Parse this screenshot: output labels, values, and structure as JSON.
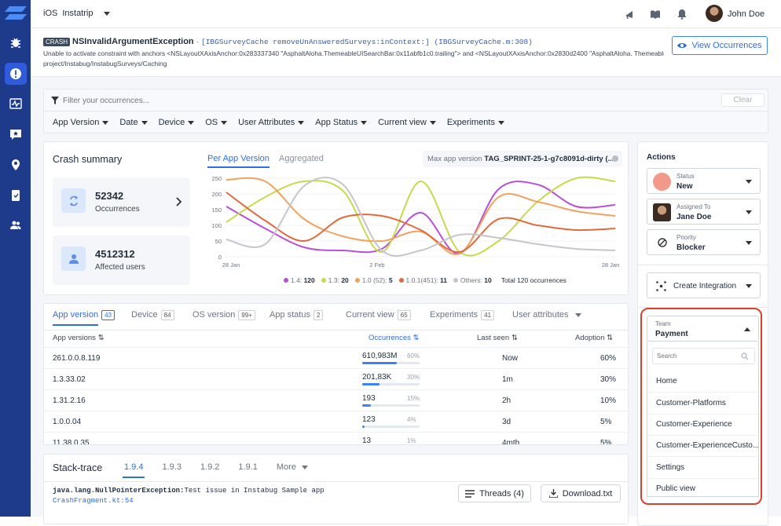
{
  "topbar": {
    "platform": "iOS",
    "app_name": "Instatrip",
    "user_name": "John Doe"
  },
  "crash": {
    "tag": "CRASH",
    "title": "NSInvalidArgumentException",
    "separator": " · ",
    "signature": "[IBGSurveyCache removeUnAnsweredSurveys:inContext:] (IBGSurveyCache.m:308)",
    "message_line1": "Unable to activate constraint with anchors <NSLayoutXAxisAnchor:0x283337340 \"AsphaltAloha.ThemeableUISearchBar:0x11abfb1c0.trailing\"> and <NSLayoutXAxisAnchor:0x2830d2400 \"AsphaltAloha. Themeable",
    "message_line2": "project/Instabug/InstabugSurveys/Caching",
    "view_occurrences": "View Occurrences"
  },
  "filter": {
    "placeholder": "Filter your occurrences...",
    "clear": "Clear",
    "dropdowns": [
      "App Version",
      "Date",
      "Device",
      "OS",
      "User Attributes",
      "App Status",
      "Current view",
      "Experiments"
    ]
  },
  "summary": {
    "title": "Crash summary",
    "occurrences_value": "52342",
    "occurrences_label": "Occurrences",
    "users_value": "4512312",
    "users_label": "Affected users",
    "tab_per_version": "Per App Version",
    "tab_aggregated": "Aggregated",
    "max_version_label": "Max app version",
    "max_version_value": "TAG_SPRINT-25-1-g7c8091d-dirty (..."
  },
  "chart_data": {
    "type": "line",
    "x": [
      "28 Jan",
      "",
      "",
      "",
      "2 Feb",
      "",
      "",
      "",
      "",
      "",
      "28 Jan"
    ],
    "yticks": [
      250,
      200,
      150,
      100,
      50,
      0
    ],
    "ylim": [
      0,
      250
    ],
    "series": [
      {
        "name": "1.4",
        "color": "#b94fd6",
        "values": [
          160,
          90,
          30,
          20,
          25,
          140,
          10,
          215,
          230,
          160,
          165
        ]
      },
      {
        "name": "1.3",
        "color": "#c9d94c",
        "values": [
          110,
          190,
          240,
          210,
          15,
          240,
          15,
          50,
          175,
          250,
          240
        ]
      },
      {
        "name": "1.0 (52)",
        "color": "#f0a35e",
        "values": [
          245,
          240,
          120,
          65,
          50,
          80,
          10,
          190,
          175,
          145,
          130
        ]
      },
      {
        "name": "1.0.1(451)",
        "color": "#e06a3e",
        "values": [
          205,
          115,
          50,
          125,
          130,
          85,
          15,
          120,
          100,
          85,
          90
        ]
      },
      {
        "name": "Others",
        "color": "#c3c6cb",
        "values": [
          55,
          40,
          225,
          230,
          20,
          20,
          70,
          60,
          40,
          25,
          20
        ]
      }
    ],
    "legend": [
      {
        "label": "1.4:",
        "value": "120",
        "color": "#b94fd6"
      },
      {
        "label": "1.3:",
        "value": "20",
        "color": "#c9d94c"
      },
      {
        "label": "1.0 (52):",
        "value": "5",
        "color": "#f0a35e"
      },
      {
        "label": "1.0.1(451):",
        "value": "11",
        "color": "#e06a3e"
      },
      {
        "label": "Others:",
        "value": "10",
        "color": "#c3c6cb"
      }
    ],
    "total": "Total 120 occurrences"
  },
  "table": {
    "tabs": [
      {
        "label": "App version",
        "badge": "43"
      },
      {
        "label": "Device",
        "badge": "84"
      },
      {
        "label": "OS version",
        "badge": "99+"
      },
      {
        "label": "App status",
        "badge": "2"
      },
      {
        "label": "Current view",
        "badge": "65"
      },
      {
        "label": "Experiments",
        "badge": "41"
      },
      {
        "label": "User attributes",
        "badge": ""
      }
    ],
    "headers": {
      "version": "App versions",
      "occurrences": "Occurrences",
      "last_seen": "Last seen",
      "adoption": "Adoption"
    },
    "rows": [
      {
        "version": "261.0.0.8.119",
        "occ": "610,983M",
        "pct": "60%",
        "fill": 0.6,
        "last_seen": "Now",
        "adoption": "60%"
      },
      {
        "version": "1.3.33.02",
        "occ": "201,83K",
        "pct": "30%",
        "fill": 0.3,
        "last_seen": "1m",
        "adoption": "30%"
      },
      {
        "version": "1.31.2.16",
        "occ": "193",
        "pct": "15%",
        "fill": 0.15,
        "last_seen": "2h",
        "adoption": "10%"
      },
      {
        "version": "1.0.0.04",
        "occ": "123",
        "pct": "4%",
        "fill": 0.04,
        "last_seen": "3d",
        "adoption": "5%"
      },
      {
        "version": "11.38.0.35",
        "occ": "13",
        "pct": "1%",
        "fill": 0.01,
        "last_seen": "4mth",
        "adoption": "5%"
      }
    ]
  },
  "stack": {
    "title": "Stack-trace",
    "tabs": [
      "1.9.4",
      "1.9.3",
      "1.9.2",
      "1.9.1",
      "More"
    ],
    "exception": "java.lang.NullPointerException:",
    "exception_msg": "Test issue in Instabug Sample app",
    "location": "CrashFragment.kt:54",
    "threads": "Threads (4)",
    "download": "Download.txt"
  },
  "actions": {
    "title": "Actions",
    "status_label": "Status",
    "status_value": "New",
    "status_color": "#f2998a",
    "assigned_label": "Assigned To",
    "assigned_value": "Jane Doe",
    "priority_label": "Priority",
    "priority_value": "Blocker",
    "integration": "Create Integration",
    "team_label": "Team",
    "team_value": "Payment",
    "search_placeholder": "Search",
    "team_options": [
      "Home",
      "Customer-Platforms",
      "Customer-Experience",
      "Customer-ExperienceCusto...",
      "Settings",
      "Public view"
    ],
    "highlight_color": "#d9412e"
  }
}
